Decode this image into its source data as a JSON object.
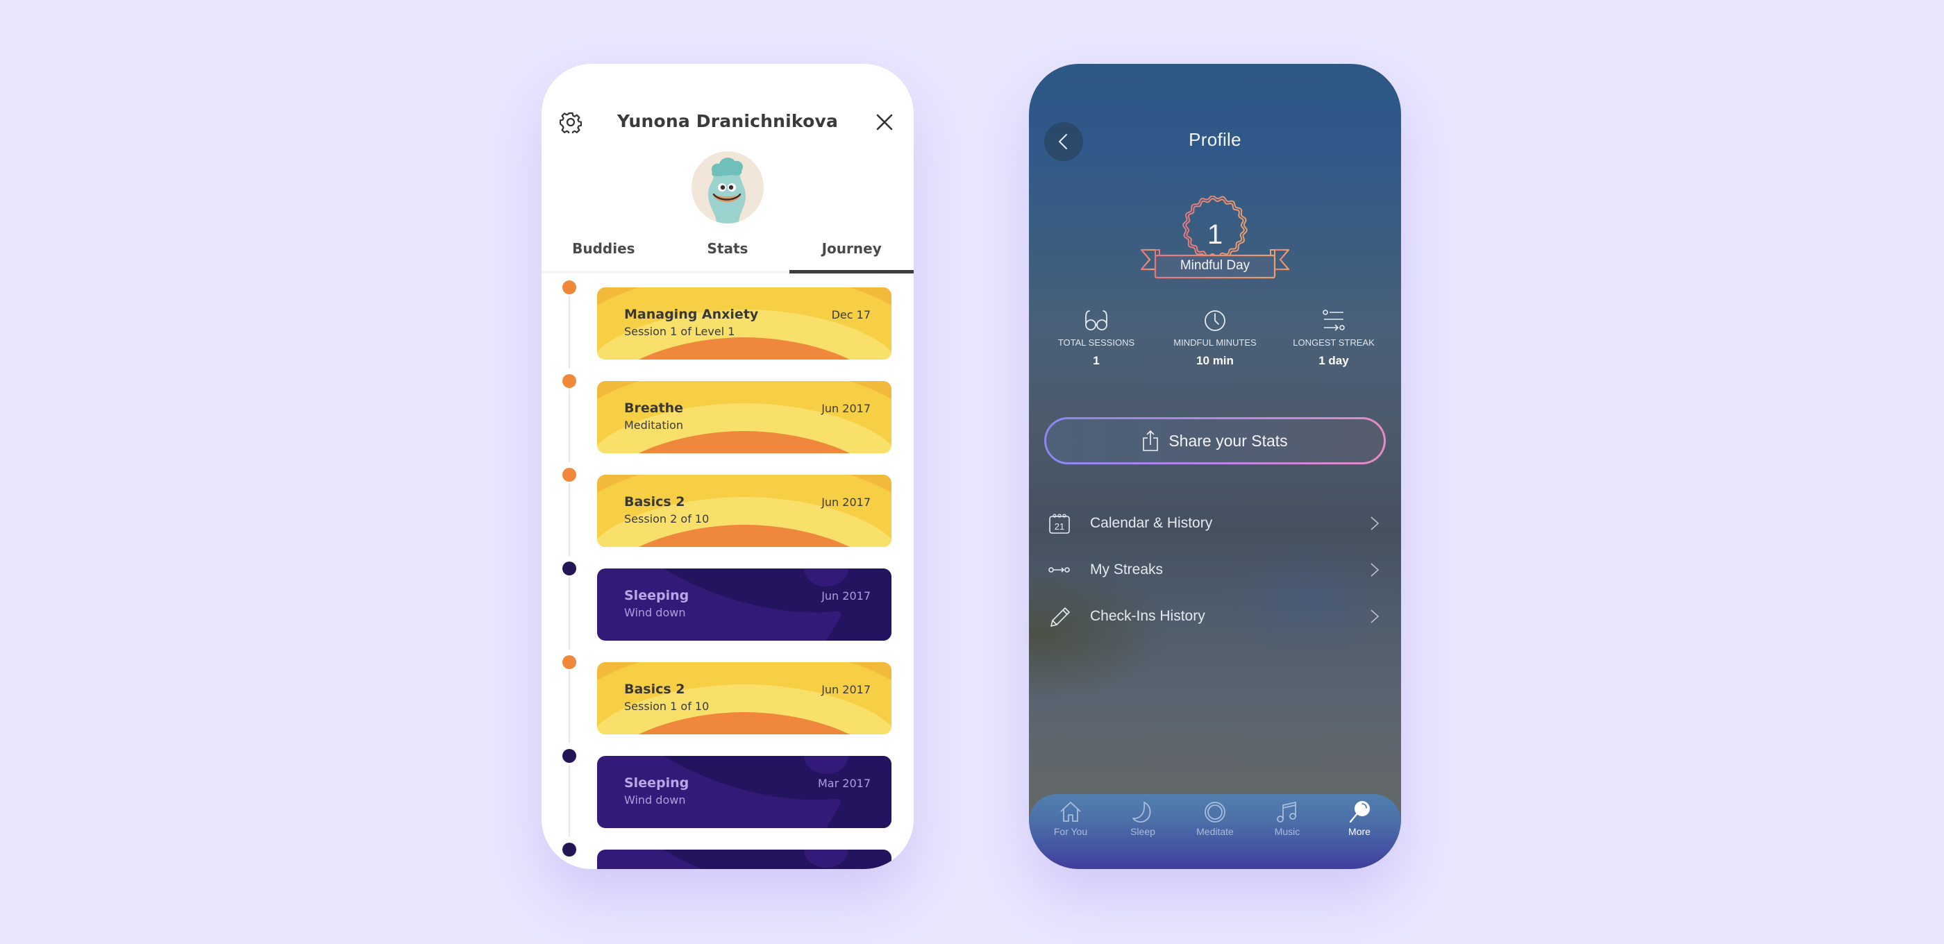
{
  "left_screen": {
    "header": {
      "title": "Yunona Dranichnikova",
      "settings_icon": "gear-icon",
      "close_icon": "close-icon"
    },
    "avatar": {
      "description": "teal smiling blob character",
      "background": "#F2E6D9"
    },
    "tabs": [
      {
        "label": "Buddies",
        "active": false
      },
      {
        "label": "Stats",
        "active": false
      },
      {
        "label": "Journey",
        "active": true
      }
    ],
    "journey": [
      {
        "title": "Managing Anxiety",
        "subtitle": "Session 1 of Level 1",
        "date": "Dec 17",
        "theme": "warm",
        "dot_color": "#F0883C"
      },
      {
        "title": "Breathe",
        "subtitle": "Meditation",
        "date": "Jun 2017",
        "theme": "warm",
        "dot_color": "#F0883C"
      },
      {
        "title": "Basics 2",
        "subtitle": "Session 2 of 10",
        "date": "Jun 2017",
        "theme": "warm",
        "dot_color": "#F0883C"
      },
      {
        "title": "Sleeping",
        "subtitle": "Wind down",
        "date": "Jun 2017",
        "theme": "night",
        "dot_color": "#231657"
      },
      {
        "title": "Basics 2",
        "subtitle": "Session 1 of 10",
        "date": "Jun 2017",
        "theme": "warm",
        "dot_color": "#F0883C"
      },
      {
        "title": "Sleeping",
        "subtitle": "Wind down",
        "date": "Mar 2017",
        "theme": "night",
        "dot_color": "#231657"
      },
      {
        "title": "",
        "subtitle": "",
        "date": "",
        "theme": "night",
        "dot_color": "#231657"
      }
    ]
  },
  "right_screen": {
    "header": {
      "title": "Profile",
      "back_icon": "chevron-left-icon"
    },
    "badge": {
      "count": "1",
      "label": "Mindful Day"
    },
    "stats": [
      {
        "icon": "glasses-icon",
        "label": "TOTAL SESSIONS",
        "value": "1"
      },
      {
        "icon": "clock-icon",
        "label": "MINDFUL MINUTES",
        "value": "10 min"
      },
      {
        "icon": "streak-icon",
        "label": "LONGEST STREAK",
        "value": "1 day"
      }
    ],
    "share_button": {
      "label": "Share your Stats",
      "icon": "share-icon"
    },
    "menu": [
      {
        "label": "Calendar & History",
        "icon": "calendar-icon",
        "calendar_day": "21"
      },
      {
        "label": "My Streaks",
        "icon": "streak-arrow-icon"
      },
      {
        "label": "Check-Ins History",
        "icon": "pencil-icon"
      }
    ],
    "tabbar": [
      {
        "label": "For You",
        "icon": "home-icon",
        "active": false
      },
      {
        "label": "Sleep",
        "icon": "moon-icon",
        "active": false
      },
      {
        "label": "Meditate",
        "icon": "meditate-ring-icon",
        "active": false
      },
      {
        "label": "Music",
        "icon": "music-note-icon",
        "active": false
      },
      {
        "label": "More",
        "icon": "more-lollipop-icon",
        "active": true
      }
    ]
  },
  "colors": {
    "page_background": "#E9E6FE",
    "warm_card": "#F7CF45",
    "warm_card_light": "#F9E06A",
    "warm_card_sun": "#EF883C",
    "night_card": "#24145F",
    "night_card_light": "#341A78",
    "share_gradient_start": "#8A86F2",
    "share_gradient_end": "#E58AC6"
  }
}
